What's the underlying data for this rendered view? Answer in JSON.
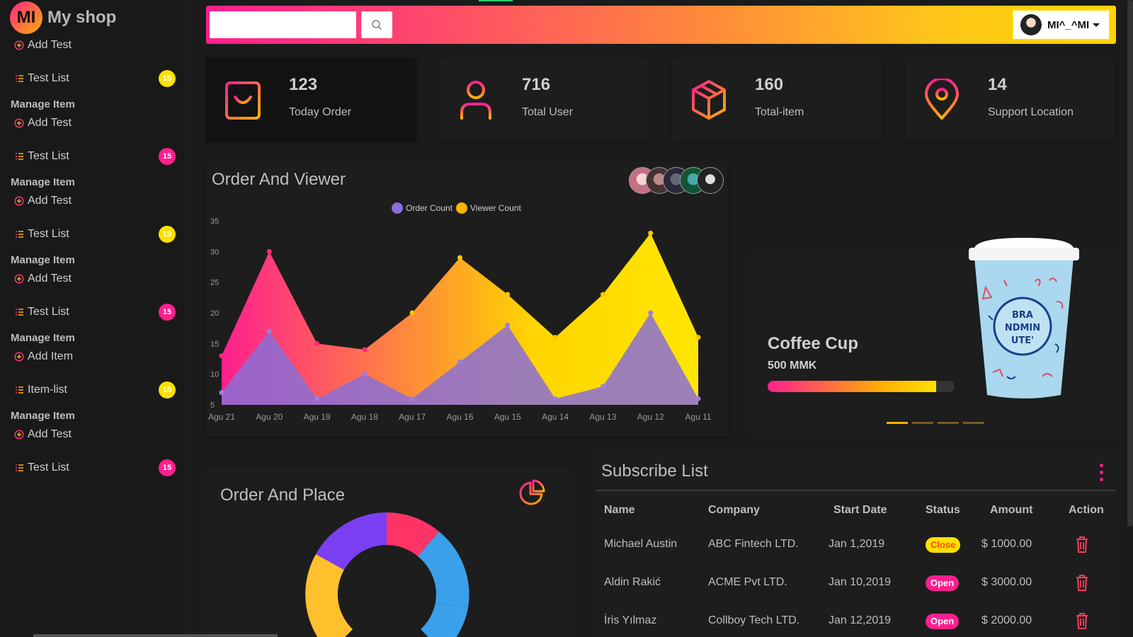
{
  "brand": {
    "logo_text": "MI",
    "name": "My shop"
  },
  "sidebar": {
    "groups": [
      {
        "title": "",
        "items": [
          {
            "label": "Add Test"
          },
          {
            "label": "Test List",
            "badge": "15",
            "badge_color": "yellow"
          }
        ]
      },
      {
        "title": "Manage Item",
        "items": [
          {
            "label": "Add Test"
          },
          {
            "label": "Test List",
            "badge": "15",
            "badge_color": "pink"
          }
        ]
      },
      {
        "title": "Manage Item",
        "items": [
          {
            "label": "Add Test"
          },
          {
            "label": "Test List",
            "badge": "15",
            "badge_color": "yellow"
          }
        ]
      },
      {
        "title": "Manage Item",
        "items": [
          {
            "label": "Add Test"
          },
          {
            "label": "Test List",
            "badge": "15",
            "badge_color": "pink"
          }
        ]
      },
      {
        "title": "Manage Item",
        "items": [
          {
            "label": "Add Item"
          },
          {
            "label": "Item-list",
            "badge": "15",
            "badge_color": "yellow"
          }
        ]
      },
      {
        "title": "Manage Item",
        "items": [
          {
            "label": "Add Test"
          },
          {
            "label": "Test List",
            "badge": "15",
            "badge_color": "pink"
          }
        ]
      }
    ]
  },
  "header": {
    "search_value": "",
    "search_placeholder": "",
    "user_name": "MI^_^MI"
  },
  "stats": [
    {
      "value": "123",
      "label": "Today Order",
      "icon": "shopping-bag-icon"
    },
    {
      "value": "716",
      "label": "Total User",
      "icon": "user-icon"
    },
    {
      "value": "160",
      "label": "Total-item",
      "icon": "box-icon"
    },
    {
      "value": "14",
      "label": "Support Location",
      "icon": "map-pin-icon"
    }
  ],
  "order_chart": {
    "title": "Order And Viewer"
  },
  "chart_data": {
    "type": "area",
    "categories": [
      "Agu 21",
      "Agu 20",
      "Agu 19",
      "Agu 18",
      "Agu 17",
      "Agu 16",
      "Agu 15",
      "Agu 14",
      "Agu 13",
      "Agu 12",
      "Agu 11"
    ],
    "series": [
      {
        "name": "Order Count",
        "values": [
          7,
          17,
          6,
          10,
          6,
          12,
          18,
          6,
          8,
          20,
          6
        ],
        "color": "#8b6fd6"
      },
      {
        "name": "Viewer Count",
        "values": [
          13,
          30,
          15,
          14,
          20,
          29,
          23,
          16,
          23,
          33,
          16
        ],
        "color": "#ffb300"
      }
    ],
    "yticks": [
      5,
      10,
      15,
      20,
      25,
      30,
      35
    ],
    "ylim": [
      5,
      35
    ],
    "legend": "top-center",
    "grid": false
  },
  "product": {
    "name": "Coffee Cup",
    "price": "500 MMK",
    "progress": 0.9,
    "cup_text": [
      "BRA",
      "NDMIN",
      "UTE'"
    ]
  },
  "place_chart": {
    "title": "Order And Place"
  },
  "subscribe": {
    "title": "Subscribe List",
    "columns": [
      "Name",
      "Company",
      "Start Date",
      "Status",
      "Amount",
      "Action"
    ],
    "rows": [
      {
        "name": "Michael Austin",
        "company": "ABC Fintech LTD.",
        "date": "Jan 1,2019",
        "status": "Close",
        "amount": "$ 1000.00"
      },
      {
        "name": "Aldin Rakić",
        "company": "ACME Pvt LTD.",
        "date": "Jan 10,2019",
        "status": "Open",
        "amount": "$ 3000.00"
      },
      {
        "name": "İris Yılmaz",
        "company": "Collboy Tech LTD.",
        "date": "Jan 12,2019",
        "status": "Open",
        "amount": "$ 2000.00"
      }
    ]
  },
  "colors": {
    "pink": "#ff1f8e",
    "yellow": "#ffe000",
    "orange": "#ffb300",
    "purple": "#8b6fd6",
    "blue": "#3aa0ea"
  }
}
